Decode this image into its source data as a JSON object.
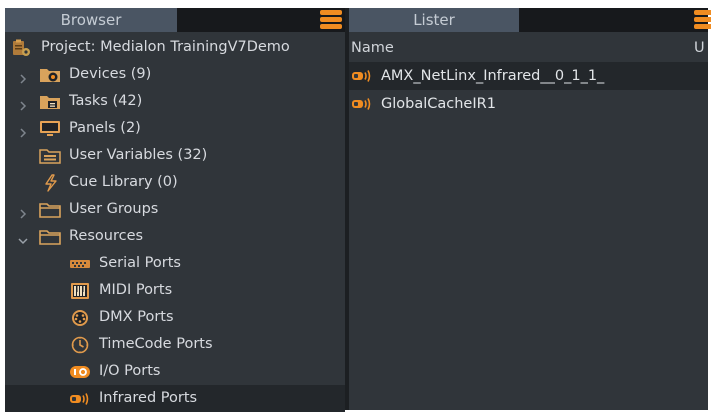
{
  "browser": {
    "tab_label": "Browser",
    "tree": [
      {
        "label": "Project: Medialon TrainingV7Demo",
        "icon": "project-icon",
        "expander": "none"
      },
      {
        "label": "Devices (9)",
        "icon": "devices-folder-icon",
        "expander": "collapsed"
      },
      {
        "label": "Tasks (42)",
        "icon": "tasks-folder-icon",
        "expander": "collapsed"
      },
      {
        "label": "Panels (2)",
        "icon": "monitor-icon",
        "expander": "collapsed"
      },
      {
        "label": "User Variables (32)",
        "icon": "variables-folder-icon",
        "expander": "none"
      },
      {
        "label": "Cue Library (0)",
        "icon": "lightning-icon",
        "expander": "none"
      },
      {
        "label": "User Groups",
        "icon": "folder-icon",
        "expander": "collapsed"
      },
      {
        "label": "Resources",
        "icon": "folder-icon",
        "expander": "expanded"
      },
      {
        "label": "Serial Ports",
        "icon": "serial-port-icon",
        "expander": "none"
      },
      {
        "label": "MIDI Ports",
        "icon": "midi-port-icon",
        "expander": "none"
      },
      {
        "label": "DMX Ports",
        "icon": "dmx-port-icon",
        "expander": "none"
      },
      {
        "label": "TimeCode Ports",
        "icon": "timecode-icon",
        "expander": "none"
      },
      {
        "label": "I/O Ports",
        "icon": "io-port-icon",
        "expander": "none"
      },
      {
        "label": "Infrared Ports",
        "icon": "infrared-icon",
        "expander": "none",
        "selected": true
      }
    ]
  },
  "lister": {
    "tab_label": "Lister",
    "columns": {
      "name": "Name",
      "u": "U"
    },
    "rows": [
      {
        "label": "AMX_NetLinx_Infrared__0_1_1_",
        "icon": "infrared-icon",
        "selected": true
      },
      {
        "label": "GlobalCacheIR1",
        "icon": "infrared-icon",
        "selected": false
      }
    ]
  },
  "colors": {
    "accent": "#f08c21",
    "panel_bg": "#30353a",
    "selected_row": "#23272b",
    "tab_active": "#4a5563"
  }
}
